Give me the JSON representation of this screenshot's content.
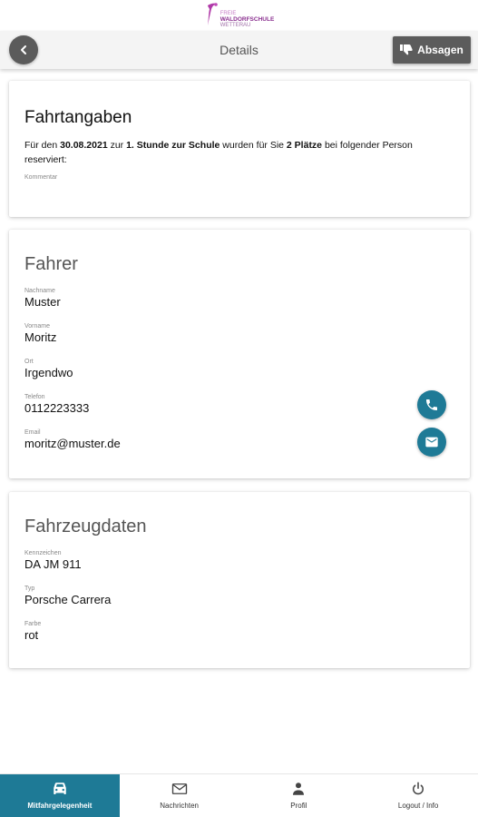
{
  "logo": {
    "line1": "FREIE",
    "line2": "WALDORFSCHULE",
    "line3": "WETTERAU"
  },
  "topbar": {
    "title": "Details",
    "cancel_label": "Absagen"
  },
  "ride_info": {
    "heading": "Fahrtangaben",
    "text_prefix": "Für den ",
    "date": "30.08.2021",
    "text_mid1": " zur ",
    "lesson": "1. Stunde zur Schule",
    "text_mid2": " wurden für Sie ",
    "seats": "2 Plätze",
    "text_suffix": " bei folgender Person reserviert:",
    "comment_label": "Kommentar"
  },
  "driver": {
    "heading": "Fahrer",
    "fields": [
      {
        "label": "Nachname",
        "value": "Muster"
      },
      {
        "label": "Vorname",
        "value": "Moritz"
      },
      {
        "label": "Ort",
        "value": "Irgendwo"
      },
      {
        "label": "Telefon",
        "value": "0112223333"
      },
      {
        "label": "Email",
        "value": "moritz@muster.de"
      }
    ]
  },
  "vehicle": {
    "heading": "Fahrzeugdaten",
    "fields": [
      {
        "label": "Kennzeichen",
        "value": "DA JM 911"
      },
      {
        "label": "Typ",
        "value": "Porsche Carrera"
      },
      {
        "label": "Farbe",
        "value": "rot"
      }
    ]
  },
  "nav": {
    "items": [
      {
        "label": "Mitfahrgelegenheit",
        "icon": "car-icon",
        "active": true
      },
      {
        "label": "Nachrichten",
        "icon": "mail-icon",
        "active": false
      },
      {
        "label": "Profil",
        "icon": "person-icon",
        "active": false
      },
      {
        "label": "Logout / Info",
        "icon": "power-icon",
        "active": false
      }
    ]
  },
  "colors": {
    "accent": "#1e7a96",
    "button_gray": "#5c5c5c",
    "brand_purple": "#8a2f8f"
  }
}
